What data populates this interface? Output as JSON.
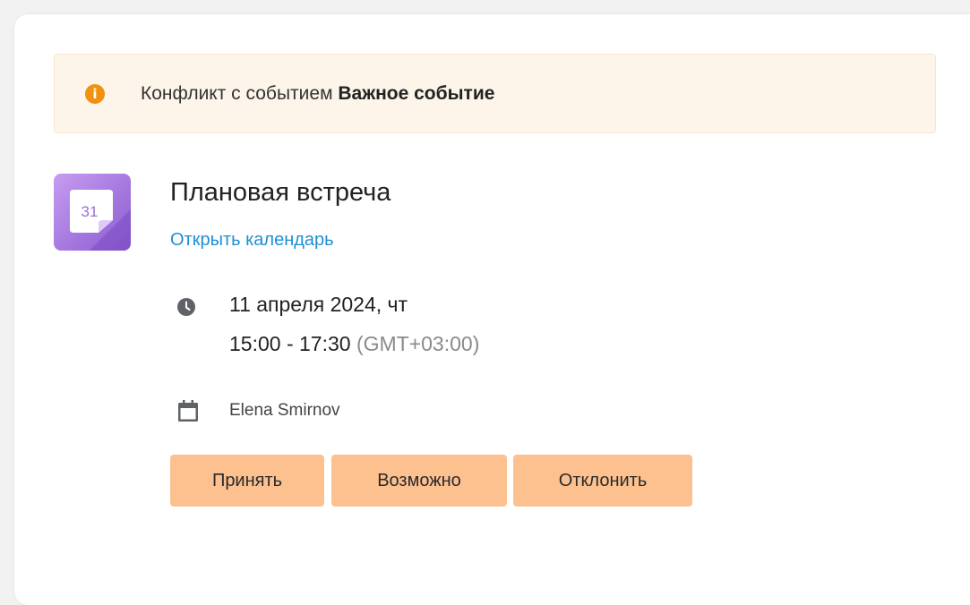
{
  "alert": {
    "prefix": "Конфликт с событием ",
    "event_name": "Важное событие",
    "icon": "info-icon"
  },
  "calendar_icon": {
    "day": "31"
  },
  "event": {
    "title": "Плановая встреча",
    "open_calendar_link": "Открыть календарь",
    "date": "11 апреля 2024, чт",
    "time": "15:00 - 17:30",
    "timezone": "(GMT+03:00)",
    "organizer": "Elena Smirnov"
  },
  "actions": {
    "accept": "Принять",
    "maybe": "Возможно",
    "decline": "Отклонить"
  },
  "colors": {
    "alert_bg": "#fdf5ea",
    "alert_icon": "#f0920f",
    "link": "#1d8fd6",
    "button_bg": "#fdc190",
    "calendar_icon_purple": "#9b6fd6"
  }
}
